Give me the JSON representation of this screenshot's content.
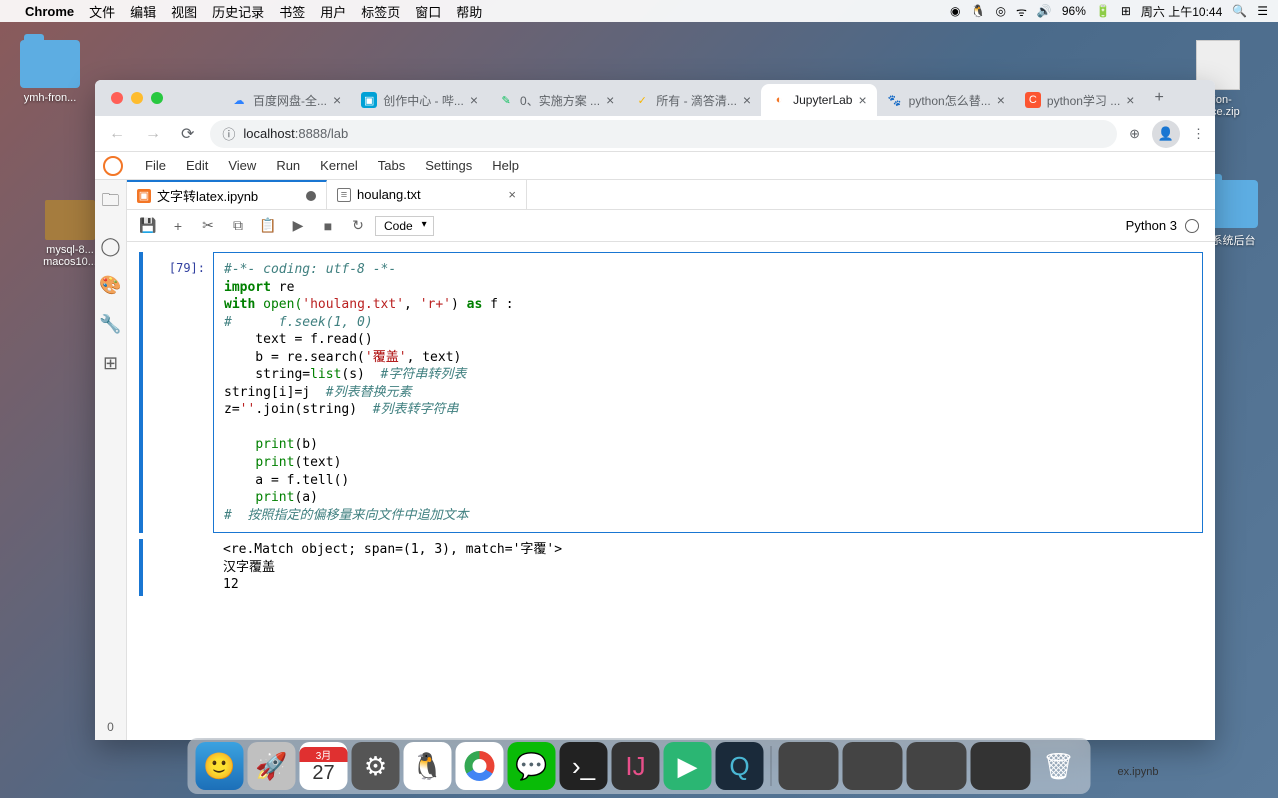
{
  "menubar": {
    "app": "Chrome",
    "items": [
      "文件",
      "编辑",
      "视图",
      "历史记录",
      "书签",
      "用户",
      "标签页",
      "窗口",
      "帮助"
    ],
    "battery": "96%",
    "clock": "周六 上午10:44"
  },
  "desktop": {
    "folder1": "ymh-fron...",
    "box1": "mysql-8...\nmacos10...",
    "zip1": "ation-\n.rvice.zip",
    "folder2": "理系统后台",
    "file_bottom": "ex.ipynb"
  },
  "chrome": {
    "tabs": [
      {
        "title": "百度网盘-全...",
        "favicon": "☁",
        "color": "#2e82ff"
      },
      {
        "title": "创作中心 - 哔...",
        "favicon": "◧",
        "color": "#00a1d6"
      },
      {
        "title": "0、实施方案 ...",
        "favicon": "✎",
        "color": "#0abf5b"
      },
      {
        "title": "所有 - 滴答清...",
        "favicon": "✓",
        "color": "#f7b500"
      },
      {
        "title": "JupyterLab",
        "favicon": "◐",
        "color": "#f37626",
        "active": true
      },
      {
        "title": "python怎么替...",
        "favicon": "🐾",
        "color": "#2e82ff"
      },
      {
        "title": "python学习 ...",
        "favicon": "C",
        "color": "#fc5531"
      }
    ],
    "url_host": "localhost",
    "url_port": ":8888",
    "url_path": "/lab"
  },
  "jupyter": {
    "menus": [
      "File",
      "Edit",
      "View",
      "Run",
      "Kernel",
      "Tabs",
      "Settings",
      "Help"
    ],
    "file_tabs": [
      {
        "name": "文字转latex.ipynb",
        "type": "nb",
        "dirty": true
      },
      {
        "name": "houlang.txt",
        "type": "txt",
        "dirty": false
      }
    ],
    "cell_type": "Code",
    "kernel_name": "Python 3",
    "prompt": "[79]:",
    "code_line1_comment": "#-*- coding: utf-8 -*-",
    "code_line2_kw": "import",
    "code_line2_mod": " re",
    "code_line3_with": "with",
    "code_line3_open": " open(",
    "code_line3_s1": "'houlang.txt'",
    "code_line3_mid": ", ",
    "code_line3_s2": "'r+'",
    "code_line3_close": ") ",
    "code_line3_as": "as",
    "code_line3_f": " f :",
    "code_line4": "#      f.seek(1, 0)",
    "code_line5": "    text = f.read()",
    "code_line6a": "    b = re.search(",
    "code_line6b": "'",
    "code_line6cjk": "覆盖",
    "code_line6c": "'",
    "code_line6d": ", text)",
    "code_line7a": "    string=",
    "code_line7b": "list",
    "code_line7c": "(s)  ",
    "code_line7_comment": "#字符串转列表",
    "code_line8a": "string[i]=j  ",
    "code_line8_comment": "#列表替换元素",
    "code_line9a": "z=",
    "code_line9b": "''",
    "code_line9c": ".join(string)  ",
    "code_line9_comment": "#列表转字符串",
    "code_line10": "",
    "code_line11a": "    ",
    "code_line11b": "print",
    "code_line11c": "(b)",
    "code_line12a": "    ",
    "code_line12b": "print",
    "code_line12c": "(text)",
    "code_line13": "    a = f.tell()",
    "code_line14a": "    ",
    "code_line14b": "print",
    "code_line14c": "(a)",
    "code_line15": "#  按照指定的偏移量来向文件中追加文本",
    "output": "<re.Match object; span=(1, 3), match='字覆'>\n汉字覆盖\n12"
  },
  "statusbar_left": "0"
}
